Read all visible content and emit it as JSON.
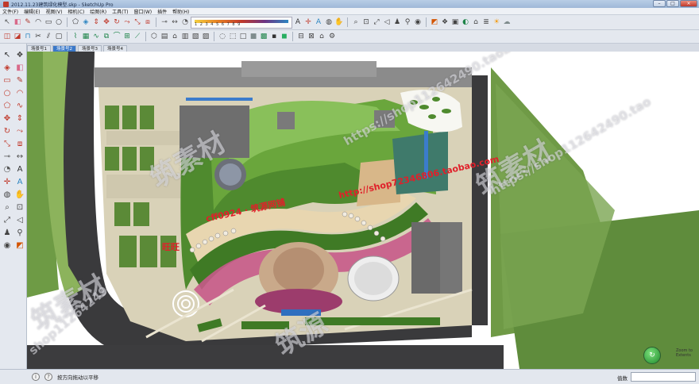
{
  "window": {
    "title": "2012.11.23建筑绿化模型.skp - SketchUp Pro",
    "buttons": {
      "minimize": "–",
      "maximize": "□",
      "close": "×"
    }
  },
  "menu": [
    "文件(F)",
    "编辑(E)",
    "视图(V)",
    "相机(C)",
    "绘图(R)",
    "工具(T)",
    "窗口(W)",
    "插件",
    "帮助(H)"
  ],
  "toolbar_row1": [
    {
      "icon": "select-arrow-icon",
      "glyph": "↖",
      "color": "#555"
    },
    {
      "icon": "eraser-icon",
      "glyph": "◧",
      "color": "#d96a8a"
    },
    {
      "icon": "pencil-line-icon",
      "glyph": "✎",
      "color": "#b03a2e"
    },
    {
      "icon": "arc-icon",
      "glyph": "◠",
      "color": "#333"
    },
    {
      "icon": "rectangle-icon",
      "glyph": "▭",
      "color": "#333"
    },
    {
      "icon": "circle-icon",
      "glyph": "○",
      "color": "#333"
    },
    {
      "icon": "polygon-icon",
      "glyph": "⬠",
      "color": "#333"
    },
    {
      "icon": "paint-bucket-icon",
      "glyph": "◈",
      "color": "#2e86c1"
    },
    {
      "icon": "push-pull-icon",
      "glyph": "⇕",
      "color": "#c0392b"
    },
    {
      "icon": "move-icon",
      "glyph": "✥",
      "color": "#c0392b"
    },
    {
      "icon": "rotate-icon",
      "glyph": "↻",
      "color": "#c0392b"
    },
    {
      "icon": "follow-me-icon",
      "glyph": "⤳",
      "color": "#c0392b"
    },
    {
      "icon": "scale-icon",
      "glyph": "⤡",
      "color": "#c0392b"
    },
    {
      "icon": "offset-icon",
      "glyph": "⧈",
      "color": "#c0392b"
    },
    {
      "icon": "tape-measure-icon",
      "glyph": "⊸",
      "color": "#555"
    },
    {
      "icon": "dimension-icon",
      "glyph": "↔",
      "color": "#555"
    },
    {
      "icon": "protractor-icon",
      "glyph": "◔",
      "color": "#555"
    },
    {
      "icon": "text-icon",
      "glyph": "A",
      "color": "#333"
    },
    {
      "icon": "axes-icon",
      "glyph": "✛",
      "color": "#c0392b"
    },
    {
      "icon": "3d-text-icon",
      "glyph": "A",
      "color": "#2e86c1"
    },
    {
      "icon": "orbit-icon",
      "glyph": "◍",
      "color": "#444"
    },
    {
      "icon": "pan-icon",
      "glyph": "✋",
      "color": "#444"
    },
    {
      "icon": "zoom-icon",
      "glyph": "⌕",
      "color": "#444"
    },
    {
      "icon": "zoom-window-icon",
      "glyph": "⊡",
      "color": "#444"
    },
    {
      "icon": "zoom-extents-icon",
      "glyph": "⤢",
      "color": "#444"
    },
    {
      "icon": "previous-view-icon",
      "glyph": "◁",
      "color": "#444"
    },
    {
      "icon": "position-camera-icon",
      "glyph": "♟",
      "color": "#444"
    },
    {
      "icon": "walk-icon",
      "glyph": "⚲",
      "color": "#444"
    },
    {
      "icon": "look-around-icon",
      "glyph": "◉",
      "color": "#444"
    },
    {
      "icon": "section-plane-icon",
      "glyph": "◩",
      "color": "#d35400"
    },
    {
      "icon": "component-icon",
      "glyph": "❖",
      "color": "#444"
    },
    {
      "icon": "group-icon",
      "glyph": "▣",
      "color": "#444"
    },
    {
      "icon": "materials-icon",
      "glyph": "◐",
      "color": "#1e8449"
    },
    {
      "icon": "warehouse-icon",
      "glyph": "⌂",
      "color": "#444"
    },
    {
      "icon": "layers-icon",
      "glyph": "≣",
      "color": "#444"
    },
    {
      "icon": "shadow-icon",
      "glyph": "☀",
      "color": "#f39c12"
    },
    {
      "icon": "fog-icon",
      "glyph": "☁",
      "color": "#7f8c8d"
    }
  ],
  "toolbar_row2": [
    {
      "icon": "solid-union-icon",
      "glyph": "◫",
      "color": "#c0392b"
    },
    {
      "icon": "solid-subtract-icon",
      "glyph": "◪",
      "color": "#c0392b"
    },
    {
      "icon": "intersect-icon",
      "glyph": "⊓",
      "color": "#2e86c1"
    },
    {
      "icon": "trim-icon",
      "glyph": "✂",
      "color": "#333"
    },
    {
      "icon": "split-icon",
      "glyph": "⫽",
      "color": "#333"
    },
    {
      "icon": "outer-shell-icon",
      "glyph": "▢",
      "color": "#333"
    },
    {
      "icon": "sandbox-contours-icon",
      "glyph": "⌇",
      "color": "#1e8449"
    },
    {
      "icon": "sandbox-scratch-icon",
      "glyph": "▦",
      "color": "#1e8449"
    },
    {
      "icon": "smoove-icon",
      "glyph": "∿",
      "color": "#1e8449"
    },
    {
      "icon": "stamp-icon",
      "glyph": "⧉",
      "color": "#1e8449"
    },
    {
      "icon": "drape-icon",
      "glyph": "⌒",
      "color": "#1e8449"
    },
    {
      "icon": "add-detail-icon",
      "glyph": "⊞",
      "color": "#1e8449"
    },
    {
      "icon": "flip-edge-icon",
      "glyph": "⟋",
      "color": "#1e8449"
    },
    {
      "icon": "iso-view-icon",
      "glyph": "⬡",
      "color": "#444"
    },
    {
      "icon": "top-view-icon",
      "glyph": "▤",
      "color": "#444"
    },
    {
      "icon": "front-view-icon",
      "glyph": "⌂",
      "color": "#444"
    },
    {
      "icon": "right-view-icon",
      "glyph": "▥",
      "color": "#444"
    },
    {
      "icon": "back-view-icon",
      "glyph": "▧",
      "color": "#444"
    },
    {
      "icon": "left-view-icon",
      "glyph": "▨",
      "color": "#444"
    },
    {
      "icon": "xray-icon",
      "glyph": "◌",
      "color": "#444"
    },
    {
      "icon": "wireframe-icon",
      "glyph": "⬚",
      "color": "#444"
    },
    {
      "icon": "hidden-line-icon",
      "glyph": "□",
      "color": "#444"
    },
    {
      "icon": "shaded-icon",
      "glyph": "■",
      "color": "#7f8c8d"
    },
    {
      "icon": "shaded-textures-icon",
      "glyph": "▩",
      "color": "#1e8449"
    },
    {
      "icon": "monochrome-icon",
      "glyph": "▪",
      "color": "#333"
    },
    {
      "icon": "materials-green-icon",
      "glyph": "◼",
      "color": "#27ae60"
    },
    {
      "icon": "camera-parallel-icon",
      "glyph": "⊟",
      "color": "#444"
    },
    {
      "icon": "camera-perspective-icon",
      "glyph": "⊠",
      "color": "#444"
    },
    {
      "icon": "house-icon",
      "glyph": "⌂",
      "color": "#444"
    },
    {
      "icon": "settings-icon",
      "glyph": "⚙",
      "color": "#444"
    }
  ],
  "style_strip": {
    "numbers": "1 2 3 4 5 6 7 8 9"
  },
  "scene_tabs": [
    "场景号1",
    "场景号2",
    "场景号3",
    "场景号4"
  ],
  "active_scene": 1,
  "left_tools": [
    {
      "icon": "select-icon",
      "glyph": "↖",
      "color": "#333"
    },
    {
      "icon": "component-make-icon",
      "glyph": "❖",
      "color": "#444"
    },
    {
      "icon": "paint-icon",
      "glyph": "◈",
      "color": "#c0392b"
    },
    {
      "icon": "eraser-icon",
      "glyph": "◧",
      "color": "#d96a8a"
    },
    {
      "icon": "rectangle-icon",
      "glyph": "▭",
      "color": "#c0392b"
    },
    {
      "icon": "line-icon",
      "glyph": "✎",
      "color": "#b03a2e"
    },
    {
      "icon": "circle-icon",
      "glyph": "○",
      "color": "#c0392b"
    },
    {
      "icon": "arc-icon",
      "glyph": "◠",
      "color": "#c0392b"
    },
    {
      "icon": "polygon-icon",
      "glyph": "⬠",
      "color": "#c0392b"
    },
    {
      "icon": "freehand-icon",
      "glyph": "∿",
      "color": "#c0392b"
    },
    {
      "icon": "move-icon",
      "glyph": "✥",
      "color": "#c0392b"
    },
    {
      "icon": "push-pull-icon",
      "glyph": "⇕",
      "color": "#c0392b"
    },
    {
      "icon": "rotate-icon",
      "glyph": "↻",
      "color": "#c0392b"
    },
    {
      "icon": "follow-me-icon",
      "glyph": "⤳",
      "color": "#c0392b"
    },
    {
      "icon": "scale-icon",
      "glyph": "⤡",
      "color": "#c0392b"
    },
    {
      "icon": "offset-icon",
      "glyph": "⧈",
      "color": "#c0392b"
    },
    {
      "icon": "tape-measure-icon",
      "glyph": "⊸",
      "color": "#555"
    },
    {
      "icon": "dimension-icon",
      "glyph": "↔",
      "color": "#555"
    },
    {
      "icon": "protractor-icon",
      "glyph": "◔",
      "color": "#555"
    },
    {
      "icon": "text-icon",
      "glyph": "A",
      "color": "#333"
    },
    {
      "icon": "axes-icon",
      "glyph": "✛",
      "color": "#c0392b"
    },
    {
      "icon": "3d-text-icon",
      "glyph": "A",
      "color": "#2e86c1"
    },
    {
      "icon": "orbit-icon",
      "glyph": "◍",
      "color": "#444"
    },
    {
      "icon": "pan-icon",
      "glyph": "✋",
      "color": "#444"
    },
    {
      "icon": "zoom-icon",
      "glyph": "⌕",
      "color": "#444"
    },
    {
      "icon": "zoom-window-icon",
      "glyph": "⊡",
      "color": "#444"
    },
    {
      "icon": "zoom-extents-icon",
      "glyph": "⤢",
      "color": "#444"
    },
    {
      "icon": "previous-icon",
      "glyph": "◁",
      "color": "#444"
    },
    {
      "icon": "position-camera-icon",
      "glyph": "♟",
      "color": "#444"
    },
    {
      "icon": "walk-icon",
      "glyph": "⚲",
      "color": "#444"
    },
    {
      "icon": "look-around-icon",
      "glyph": "◉",
      "color": "#444"
    },
    {
      "icon": "section-icon",
      "glyph": "◩",
      "color": "#d35400"
    }
  ],
  "overlays": {
    "red_url": "http://shop72346806.taobao.com",
    "red_id": "cff0924 · 筑源网铺",
    "red_wangwang": "旺旺",
    "watermark_1": "筑素材",
    "watermark_2": "筑素材",
    "watermark_3": "筑素材",
    "watermark_4": "筑源",
    "watermark_url_1": "https://shop112642490.taobao.com",
    "watermark_url_2": "https://shop112642490.tao",
    "watermark_url_3": "shop11264249"
  },
  "navigator": {
    "label_line1": "Zoom to",
    "label_line2": "Extents"
  },
  "status": {
    "text": "按方向拖动以平移",
    "measure_label": "值数"
  }
}
